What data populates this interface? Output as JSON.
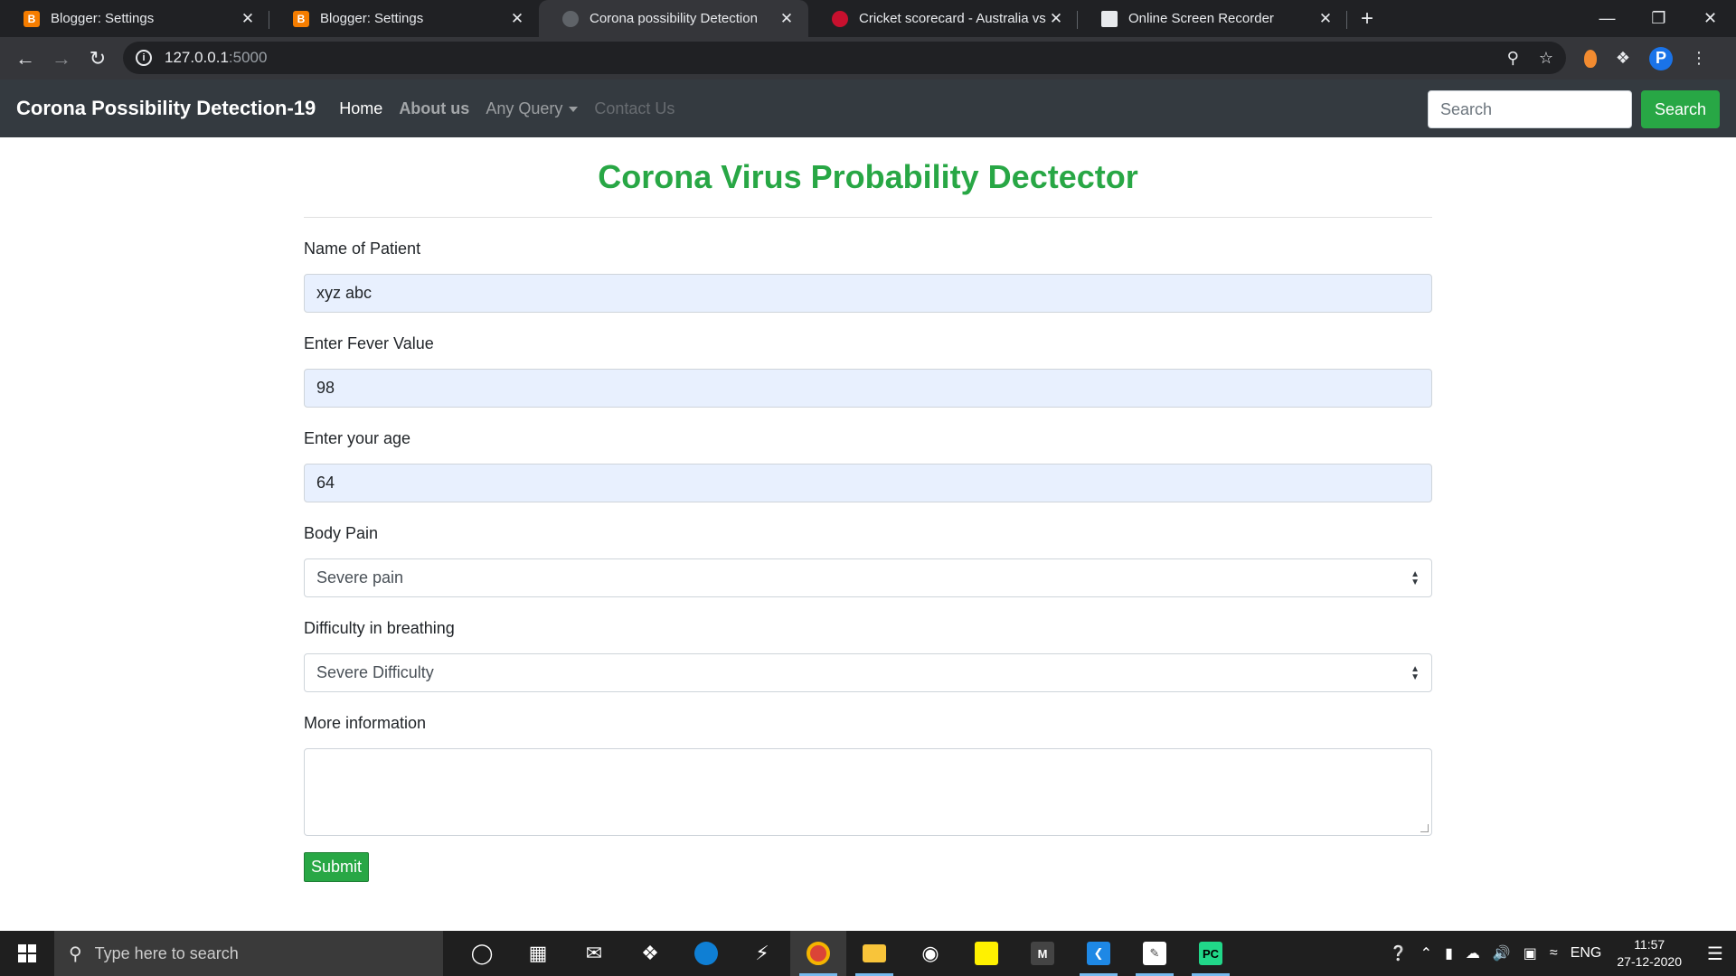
{
  "browser": {
    "tabs": [
      {
        "title": "Blogger: Settings",
        "favicon": "blogger-icon"
      },
      {
        "title": "Blogger: Settings",
        "favicon": "blogger-icon"
      },
      {
        "title": "Corona possibility Detection",
        "favicon": "globe-icon"
      },
      {
        "title": "Cricket scorecard - Australia vs In",
        "favicon": "cricket-icon"
      },
      {
        "title": "Online Screen Recorder",
        "favicon": "recorder-icon"
      }
    ],
    "active_tab_index": 2,
    "url_host": "127.0.0.1",
    "url_port": ":5000"
  },
  "site": {
    "brand": "Corona Possibility Detection-19",
    "nav": {
      "home": "Home",
      "about": "About us",
      "query": "Any Query",
      "contact": "Contact Us"
    },
    "search_placeholder": "Search",
    "search_button": "Search"
  },
  "form": {
    "title": "Corona Virus Probability Dectector",
    "name_label": "Name of Patient",
    "name_value": "xyz abc",
    "fever_label": "Enter Fever Value",
    "fever_value": "98",
    "age_label": "Enter your age",
    "age_value": "64",
    "pain_label": "Body Pain",
    "pain_value": "Severe pain",
    "breathing_label": "Difficulty in breathing",
    "breathing_value": "Severe Difficulty",
    "info_label": "More information",
    "info_value": "",
    "submit": "Submit"
  },
  "taskbar": {
    "search_placeholder": "Type here to search",
    "language": "ENG",
    "time": "11:57",
    "date": "27-12-2020"
  },
  "colors": {
    "accent_green": "#28a745",
    "navbar_dark": "#343a40",
    "autofill_blue": "#e8f0fe"
  }
}
